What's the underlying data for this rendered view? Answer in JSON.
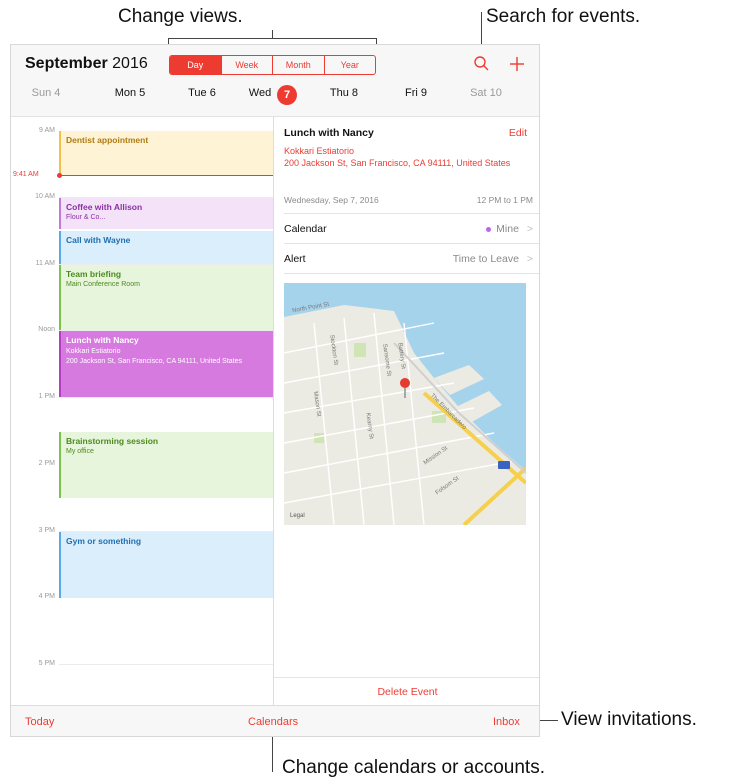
{
  "callouts": {
    "change_views": "Change views.",
    "search_events": "Search for events.",
    "view_invitations": "View invitations.",
    "change_calendars": "Change calendars or accounts."
  },
  "header": {
    "month": "September",
    "year": "2016",
    "view_tabs": [
      "Day",
      "Week",
      "Month",
      "Year"
    ],
    "active_tab": "Day",
    "search_icon": "magnifier-icon",
    "add_icon": "plus-icon"
  },
  "week": {
    "days": [
      "Sun 4",
      "Mon 5",
      "Tue 6",
      "Wed",
      "Thu 8",
      "Fri 9",
      "Sat 10"
    ],
    "today_number": "7"
  },
  "dayview": {
    "hours": [
      "9 AM",
      "10 AM",
      "11 AM",
      "Noon",
      "1 PM",
      "2 PM",
      "3 PM",
      "4 PM",
      "5 PM"
    ],
    "now": "9:41 AM",
    "events": [
      {
        "title": "Dentist appointment",
        "sub": "",
        "color": "#fff3d6",
        "bar": "#f3c14a",
        "text": "#b07a10"
      },
      {
        "title": "Coffee with Allison",
        "sub": "Flour & Co...",
        "color": "#f4e3f8",
        "bar": "#c27ad8",
        "text": "#8b2fa6"
      },
      {
        "title": "Call with Wayne",
        "sub": "",
        "color": "#dbeefb",
        "bar": "#5aa9e6",
        "text": "#1f6fb0"
      },
      {
        "title": "Team briefing",
        "sub": "Main Conference Room",
        "color": "#e6f5dc",
        "bar": "#7ac24d",
        "text": "#4d8a1e"
      },
      {
        "title": "Lunch with Nancy",
        "sub": "Kokkari Estiatorio\n200 Jackson St, San Francisco, CA  94111, United States",
        "color": "#d77ae0",
        "bar": "#b43dc4",
        "text": "#ffffff"
      },
      {
        "title": "Brainstorming session",
        "sub": "My office",
        "color": "#e6f5dc",
        "bar": "#7ac24d",
        "text": "#4d8a1e"
      },
      {
        "title": "Gym or something",
        "sub": "",
        "color": "#dbeefb",
        "bar": "#5aa9e6",
        "text": "#1f6fb0"
      }
    ]
  },
  "detail": {
    "title": "Lunch with Nancy",
    "edit": "Edit",
    "location": "Kokkari Estiatorio\n200 Jackson St, San Francisco, CA  94111, United States",
    "date": "Wednesday, Sep 7, 2016",
    "time": "12 PM to 1 PM",
    "calendar_label": "Calendar",
    "calendar_value": "Mine",
    "alert_label": "Alert",
    "alert_value": "Time to Leave",
    "chevron": ">",
    "delete": "Delete Event",
    "map_labels": [
      "North Point St",
      "Stockton St",
      "Sansome St",
      "Battery St",
      "Mason St",
      "Kearny St",
      "The Embarcadero",
      "Mission St",
      "Folsom St",
      "Legal"
    ]
  },
  "toolbar": {
    "today": "Today",
    "calendars": "Calendars",
    "inbox": "Inbox"
  },
  "accent": "#ee3b32"
}
